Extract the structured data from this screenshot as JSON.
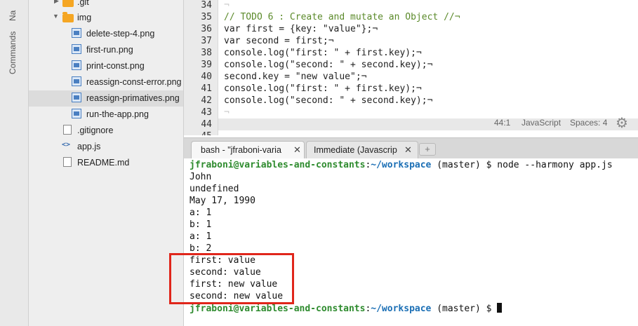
{
  "side_rail": {
    "top_label": "Na",
    "commands_label": "Commands"
  },
  "file_tree": [
    {
      "name": ".git",
      "type": "folder",
      "arrow": "▶"
    },
    {
      "name": "img",
      "type": "folder",
      "arrow": "▼"
    },
    {
      "name": "delete-step-4.png",
      "type": "image"
    },
    {
      "name": "first-run.png",
      "type": "image"
    },
    {
      "name": "print-const.png",
      "type": "image"
    },
    {
      "name": "reassign-const-error.png",
      "type": "image"
    },
    {
      "name": "reassign-primatives.png",
      "type": "image",
      "selected": true
    },
    {
      "name": "run-the-app.png",
      "type": "image"
    },
    {
      "name": ".gitignore",
      "type": "file"
    },
    {
      "name": "app.js",
      "type": "js"
    },
    {
      "name": "README.md",
      "type": "file"
    }
  ],
  "editor": {
    "line_numbers": [
      "34",
      "35",
      "36",
      "37",
      "38",
      "39",
      "40",
      "41",
      "42",
      "43",
      "44",
      "45"
    ],
    "lines": [
      "¬",
      "// TODO 6 : Create and mutate an Object //¬",
      "var first = {key: \"value\"};¬",
      "var second = first;¬",
      "console.log(\"first: \" + first.key);¬",
      "console.log(\"second: \" + second.key);¬",
      "second.key = \"new value\";¬",
      "console.log(\"first: \" + first.key);¬",
      "console.log(\"second: \" + second.key);¬",
      "¬",
      "",
      ""
    ],
    "status": {
      "position": "44:1",
      "language": "JavaScript",
      "spaces": "Spaces: 4"
    }
  },
  "tabs": [
    {
      "label": "bash - \"jfraboni-varia",
      "active": true
    },
    {
      "label": "Immediate (Javascrip",
      "active": false
    }
  ],
  "colors": {
    "prompt_user": "#2e8b2e",
    "prompt_path": "#1b6fb5",
    "highlight": "#e0261b"
  },
  "terminal": {
    "prompt_user": "jfraboni@variables-and-constants",
    "prompt_colon": ":",
    "prompt_path": "~/workspace",
    "prompt_rest": " (master) $",
    "command": " node --harmony app.js",
    "output": [
      "John",
      "undefined",
      "May 17, 1990",
      "a: 1",
      "b: 1",
      "a: 1",
      "b: 2",
      "first: value",
      "second: value",
      "first: new value",
      "second: new value"
    ]
  }
}
